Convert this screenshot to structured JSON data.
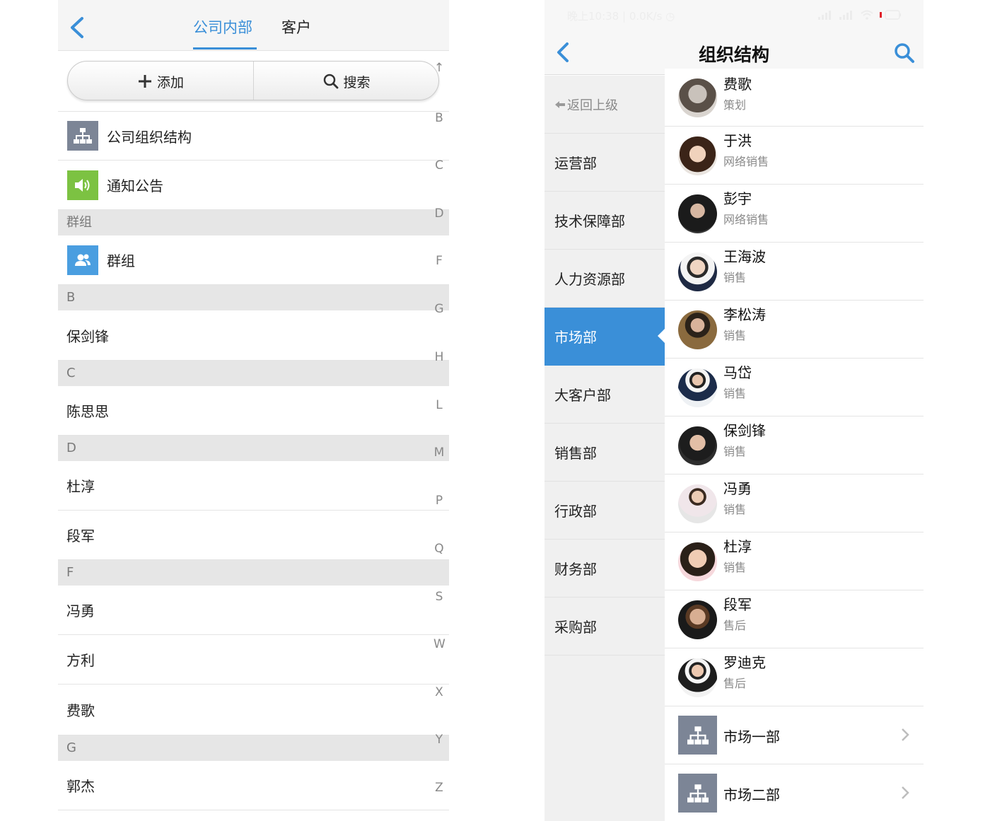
{
  "left": {
    "tabs": [
      {
        "label": "公司内部",
        "active": true
      },
      {
        "label": "客户",
        "active": false
      }
    ],
    "actions": {
      "add_label": "添加",
      "search_label": "搜索"
    },
    "entries": [
      {
        "label": "公司组织结构",
        "icon": "org-chart-icon",
        "color": "#7c8596"
      },
      {
        "label": "通知公告",
        "icon": "speaker-icon",
        "color": "#7cc242"
      }
    ],
    "sections": [
      {
        "header": "群组",
        "items": [
          "群组"
        ]
      },
      {
        "header": "B",
        "items": [
          "保剑锋"
        ]
      },
      {
        "header": "C",
        "items": [
          "陈思思"
        ]
      },
      {
        "header": "D",
        "items": [
          "杜淳",
          "段军"
        ]
      },
      {
        "header": "F",
        "items": [
          "冯勇",
          "方利",
          "费歌"
        ]
      },
      {
        "header": "G",
        "items": [
          "郭杰"
        ]
      }
    ],
    "group_icon_color": "#4a9ee0",
    "index_letters": [
      "↑",
      "B",
      "C",
      "D",
      "F",
      "G",
      "H",
      "L",
      "M",
      "P",
      "Q",
      "S",
      "W",
      "X",
      "Y",
      "Z"
    ]
  },
  "right": {
    "status_text": "晚上10:38 | 0.0K/s ◷",
    "title": "组织结构",
    "sidebar": {
      "back_label": "返回上级",
      "items": [
        {
          "label": "运营部"
        },
        {
          "label": "技术保障部"
        },
        {
          "label": "人力资源部"
        },
        {
          "label": "市场部",
          "active": true
        },
        {
          "label": "大客户部"
        },
        {
          "label": "销售部"
        },
        {
          "label": "行政部"
        },
        {
          "label": "财务部"
        },
        {
          "label": "采购部"
        }
      ]
    },
    "members": [
      {
        "name": "费歌",
        "role": "策划"
      },
      {
        "name": "于洪",
        "role": "网络销售"
      },
      {
        "name": "彭宇",
        "role": "网络销售"
      },
      {
        "name": "王海波",
        "role": "销售"
      },
      {
        "name": "李松涛",
        "role": "销售"
      },
      {
        "name": "马岱",
        "role": "销售"
      },
      {
        "name": "保剑锋",
        "role": "销售"
      },
      {
        "name": "冯勇",
        "role": "销售"
      },
      {
        "name": "杜淳",
        "role": "销售"
      },
      {
        "name": "段军",
        "role": "售后"
      },
      {
        "name": "罗迪克",
        "role": "售后"
      }
    ],
    "sub_departments": [
      {
        "label": "市场一部"
      },
      {
        "label": "市场二部"
      }
    ],
    "accent_color": "#3a8fd8"
  }
}
